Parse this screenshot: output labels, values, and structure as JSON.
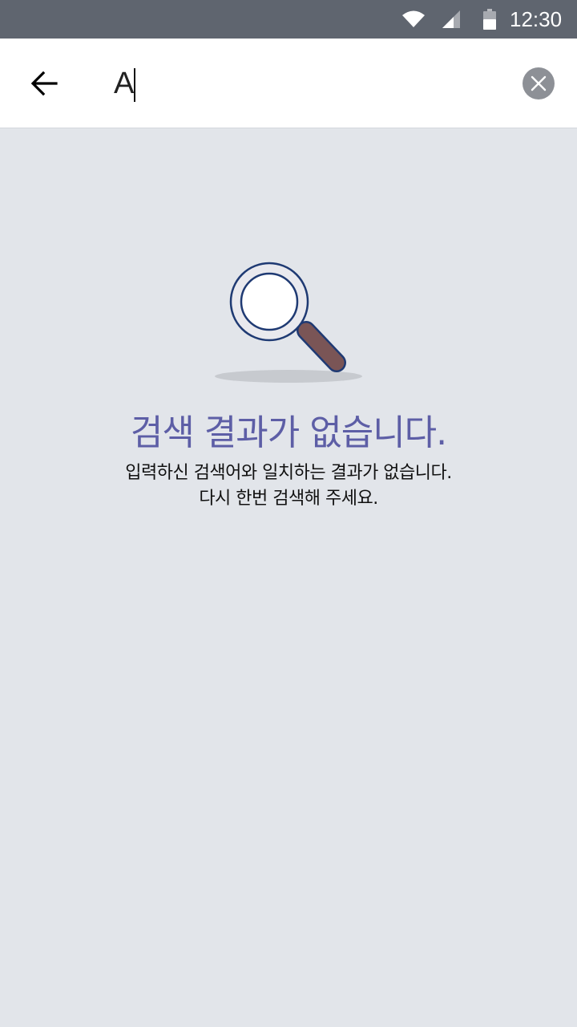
{
  "status_bar": {
    "time": "12:30",
    "icons": [
      "wifi-icon",
      "cellular-signal-icon",
      "battery-icon"
    ]
  },
  "search": {
    "query": "A",
    "back_icon": "arrow-left-icon",
    "clear_icon": "close-icon"
  },
  "empty_state": {
    "icon": "magnifying-glass-icon",
    "title": "검색 결과가 없습니다.",
    "description_line1": "입력하신 검색어와 일치하는 결과가 없습니다.",
    "description_line2": "다시 한번 검색해 주세요."
  },
  "colors": {
    "status_bar_bg": "#5f656f",
    "header_bg": "#ffffff",
    "page_bg": "#e2e5ea",
    "title_color": "#5d5ea6",
    "clear_button_bg": "#8d9096",
    "magnifier_outline": "#1f3a73",
    "magnifier_handle": "#7a5556"
  }
}
